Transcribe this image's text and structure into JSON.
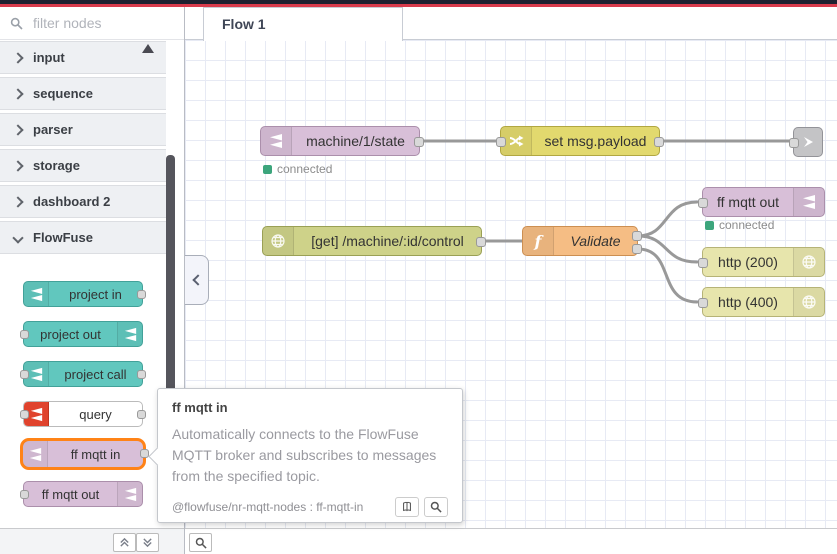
{
  "palette": {
    "search": {
      "placeholder": "filter nodes"
    },
    "categories": [
      {
        "label": "input",
        "expanded": false
      },
      {
        "label": "sequence",
        "expanded": false
      },
      {
        "label": "parser",
        "expanded": false
      },
      {
        "label": "storage",
        "expanded": false
      },
      {
        "label": "dashboard 2",
        "expanded": false
      },
      {
        "label": "FlowFuse",
        "expanded": true
      }
    ],
    "nodes": [
      {
        "label": "project in"
      },
      {
        "label": "project out"
      },
      {
        "label": "project call"
      },
      {
        "label": "query"
      },
      {
        "label": "ff mqtt in",
        "highlighted": true
      },
      {
        "label": "ff mqtt out"
      }
    ]
  },
  "workspace": {
    "tab_label": "Flow 1"
  },
  "canvas": {
    "nodes": [
      {
        "label": "machine/1/state",
        "type": "ff-mqtt-in",
        "status": "connected"
      },
      {
        "label": "set msg.payload",
        "type": "change"
      },
      {
        "label": "",
        "type": "link-out"
      },
      {
        "label": "[get] /machine/:id/control",
        "type": "http-in"
      },
      {
        "label": "Validate",
        "type": "function",
        "outputs": 2
      },
      {
        "label": "ff mqtt out",
        "type": "ff-mqtt-out",
        "status": "connected"
      },
      {
        "label": "http (200)",
        "type": "http-response"
      },
      {
        "label": "http (400)",
        "type": "http-response"
      }
    ]
  },
  "tooltip": {
    "title": "ff mqtt in",
    "body": "Automatically connects to the FlowFuse MQTT broker and subscribes to messages from the specified topic.",
    "module": "@flowfuse/nr-mqtt-nodes : ff-mqtt-in"
  },
  "colors": {
    "header_dark": "#1d2130",
    "header_red": "#d83b4c",
    "mqtt_node": "#d8bfd8",
    "change_node": "#e2d96e",
    "http_in_node": "#ced289",
    "http_response_node": "#e7e5ac",
    "function_node": "#f5bd84",
    "link_node": "#c4c4c6",
    "project_node": "#61c7be",
    "query_icon": "#e0432d",
    "status_green": "#3ca57c",
    "wire": "#999999",
    "highlight_orange": "#ff8317"
  }
}
